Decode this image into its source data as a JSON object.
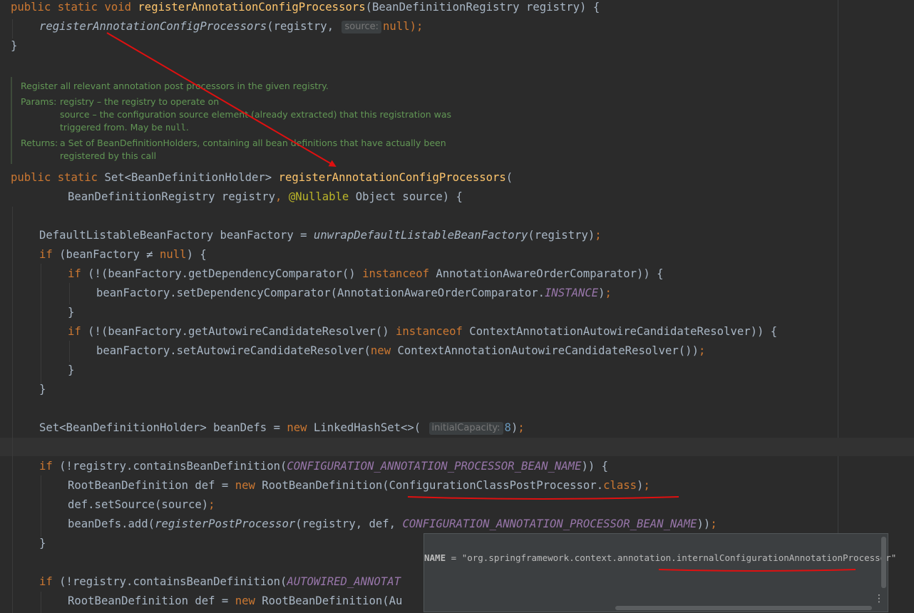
{
  "code": {
    "line1": {
      "kw1": "public",
      "kw2": "static",
      "kw3": "void",
      "fn": "registerAnnotationConfigProcessors",
      "params": "(BeanDefinitionRegistry registry) {"
    },
    "line2": {
      "call": "registerAnnotationConfigProcessors",
      "open": "(registry,",
      "hint": "source:",
      "arg": "null",
      "close": ");"
    },
    "line3": "}",
    "doc": {
      "summary": "Register all relevant annotation post processors in the given registry.",
      "params_label": "Params:",
      "param1": "registry – the registry to operate on",
      "param2": "source – the configuration source element (already extracted) that this registration was",
      "param2b_pre": "triggered from. May be ",
      "param2b_code": "null",
      "param2b_post": ".",
      "returns_label": "Returns:",
      "returns1": "a Set of BeanDefinitionHolders, containing all bean definitions that have actually been",
      "returns2": "registered by this call"
    },
    "line5": {
      "kw1": "public",
      "kw2": "static",
      "type": "Set<BeanDefinitionHolder>",
      "fn": "registerAnnotationConfigProcessors",
      "open": "("
    },
    "line6": {
      "p1": "BeanDefinitionRegistry registry",
      "comma": ",",
      "ann": "@Nullable",
      "p2": "Object source) {"
    },
    "line8": {
      "type": "DefaultListableBeanFactory beanFactory = ",
      "call": "unwrapDefaultListableBeanFactory",
      "args": "(registry)",
      "semi": ";"
    },
    "line9": {
      "kw": "if",
      "pre": " (beanFactory ≠ ",
      "null": "null",
      "post": ") {"
    },
    "line10": {
      "kw": "if",
      "pre": " (!(beanFactory.getDependencyComparator() ",
      "inst": "instanceof",
      "post": " AnnotationAwareOrderComparator)) {"
    },
    "line11": {
      "pre": "beanFactory.setDependencyComparator(AnnotationAwareOrderComparator.",
      "const": "INSTANCE",
      "post": ")",
      "semi": ";"
    },
    "line12": "}",
    "line13": {
      "kw": "if",
      "pre": " (!(beanFactory.getAutowireCandidateResolver() ",
      "inst": "instanceof",
      "post": " ContextAnnotationAutowireCandidateResolver)) {"
    },
    "line14": {
      "pre": "beanFactory.setAutowireCandidateResolver(",
      "new": "new",
      "post": " ContextAnnotationAutowireCandidateResolver())",
      "semi": ";"
    },
    "line15": "}",
    "line16": "}",
    "line18": {
      "pre": "Set<BeanDefinitionHolder> beanDefs = ",
      "new": "new",
      "post": " LinkedHashSet<>(",
      "hint": "initialCapacity:",
      "arg": "8",
      "close": ")",
      "semi": ";"
    },
    "line20": {
      "kw": "if",
      "pre": " (!registry.containsBeanDefinition(",
      "const": "CONFIGURATION_ANNOTATION_PROCESSOR_BEAN_NAME",
      "post": ")) {"
    },
    "line21": {
      "pre": "RootBeanDefinition def = ",
      "new": "new",
      "mid": " RootBeanDefinition(",
      "cls": "ConfigurationClassPostProcessor.",
      "clskw": "class",
      "post": ")",
      "semi": ";"
    },
    "line22": {
      "pre": "def.setSource(source)",
      "semi": ";"
    },
    "line23": {
      "pre": "beanDefs.add(",
      "call": "registerPostProcessor",
      "mid": "(registry, def, ",
      "const": "CONFIGURATION_ANNOTATION_PROCESSOR_BEAN_NAME",
      "post": "))",
      "semi": ";"
    },
    "line24": "}",
    "line26": {
      "kw": "if",
      "pre": " (!registry.containsBeanDefinition(",
      "const": "AUTOWIRED_ANNOTAT"
    },
    "line27": {
      "pre": "RootBeanDefinition def = ",
      "new": "new",
      "post": " RootBeanDefinition(Au"
    }
  },
  "popup": {
    "name": "NAME",
    "eq": " = ",
    "value": "\"org.springframework.context.annotation.internalConfigurationAnnotationProcessor\"",
    "menu_icon": "⋮"
  },
  "colors": {
    "background": "#2b2b2b",
    "keyword": "#cc7832",
    "method": "#ffc66d",
    "constant": "#9876aa",
    "doc": "#629755",
    "annotation_red": "#e01010"
  }
}
